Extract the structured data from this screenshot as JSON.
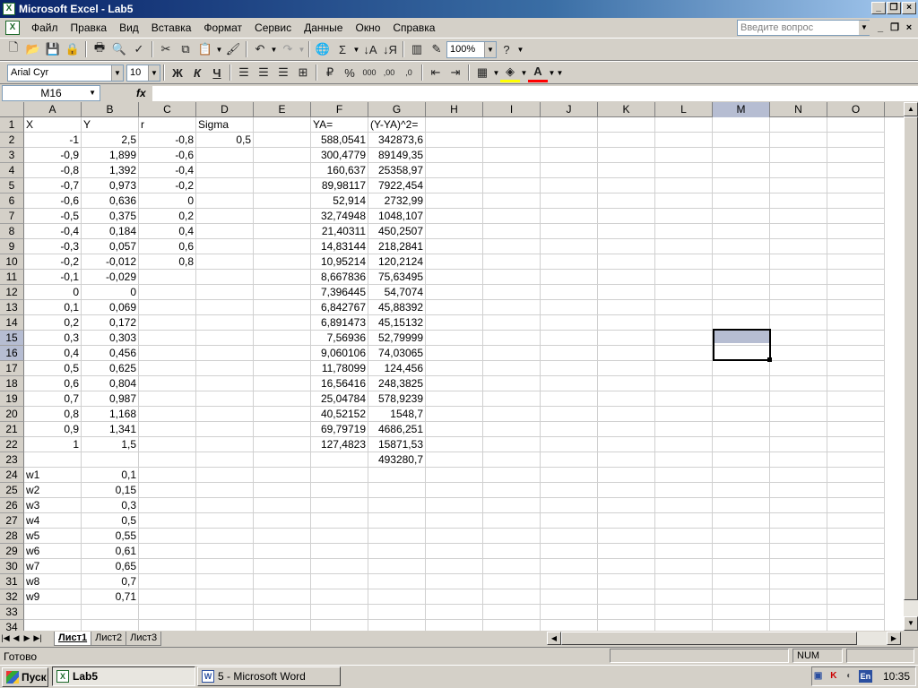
{
  "window": {
    "title": "Microsoft Excel - Lab5"
  },
  "menu": [
    "Файл",
    "Правка",
    "Вид",
    "Вставка",
    "Формат",
    "Сервис",
    "Данные",
    "Окно",
    "Справка"
  ],
  "ask_placeholder": "Введите вопрос",
  "toolbar": {
    "zoom": "100%"
  },
  "format": {
    "font": "Arial Cyr",
    "size": "10",
    "bold_label": "Ж",
    "italic_label": "К",
    "underline_label": "Ч"
  },
  "namebox": "M16",
  "fx": "fx",
  "columns": [
    "A",
    "B",
    "C",
    "D",
    "E",
    "F",
    "G",
    "H",
    "I",
    "J",
    "K",
    "L",
    "M",
    "N",
    "O"
  ],
  "rows": [
    "1",
    "2",
    "3",
    "4",
    "5",
    "6",
    "7",
    "8",
    "9",
    "10",
    "11",
    "12",
    "13",
    "14",
    "15",
    "16",
    "17",
    "18",
    "19",
    "20",
    "21",
    "22",
    "23",
    "24",
    "25",
    "26",
    "27",
    "28",
    "29",
    "30",
    "31",
    "32",
    "33",
    "34"
  ],
  "cells": {
    "A": [
      "X",
      "-1",
      "-0,9",
      "-0,8",
      "-0,7",
      "-0,6",
      "-0,5",
      "-0,4",
      "-0,3",
      "-0,2",
      "-0,1",
      "0",
      "0,1",
      "0,2",
      "0,3",
      "0,4",
      "0,5",
      "0,6",
      "0,7",
      "0,8",
      "0,9",
      "1",
      "",
      "w1",
      "w2",
      "w3",
      "w4",
      "w5",
      "w6",
      "w7",
      "w8",
      "w9"
    ],
    "B": [
      "Y",
      "2,5",
      "1,899",
      "1,392",
      "0,973",
      "0,636",
      "0,375",
      "0,184",
      "0,057",
      "-0,012",
      "-0,029",
      "0",
      "0,069",
      "0,172",
      "0,303",
      "0,456",
      "0,625",
      "0,804",
      "0,987",
      "1,168",
      "1,341",
      "1,5",
      "",
      "0,1",
      "0,15",
      "0,3",
      "0,5",
      "0,55",
      "0,61",
      "0,65",
      "0,7",
      "0,71"
    ],
    "C": [
      "r",
      "-0,8",
      "-0,6",
      "-0,4",
      "-0,2",
      "0",
      "0,2",
      "0,4",
      "0,6",
      "0,8"
    ],
    "D": [
      "Sigma",
      "0,5"
    ],
    "F": [
      "YA=",
      "588,0541",
      "300,4779",
      "160,637",
      "89,98117",
      "52,914",
      "32,74948",
      "21,40311",
      "14,83144",
      "10,95214",
      "8,667836",
      "7,396445",
      "6,842767",
      "6,891473",
      "7,56936",
      "9,060106",
      "11,78099",
      "16,56416",
      "25,04784",
      "40,52152",
      "69,79719",
      "127,4823"
    ],
    "G": [
      "(Y-YA)^2=",
      "342873,6",
      "89149,35",
      "25358,97",
      "7922,454",
      "2732,99",
      "1048,107",
      "450,2507",
      "218,2841",
      "120,2124",
      "75,63495",
      "54,7074",
      "45,88392",
      "45,15132",
      "52,79999",
      "74,03065",
      "124,456",
      "248,3825",
      "578,9239",
      "1548,7",
      "4686,251",
      "15871,53",
      "493280,7"
    ]
  },
  "sheets": [
    "Лист1",
    "Лист2",
    "Лист3"
  ],
  "status": {
    "text": "Готово",
    "num": "NUM"
  },
  "taskbar": {
    "start": "Пуск",
    "task1": "Lab5",
    "task2": "5 - Microsoft Word",
    "lang": "En",
    "time": "10:35"
  }
}
